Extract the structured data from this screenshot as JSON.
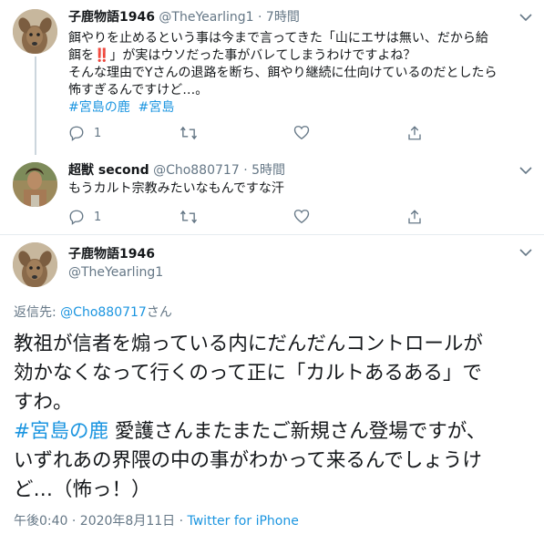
{
  "tweets": [
    {
      "name": "子鹿物語1946",
      "handle": "@TheYearling1",
      "separator": "·",
      "time": "7時間",
      "lines": [
        "餌やりを止めるという事は今まで言ってきた「山にエサは無い、だから給",
        "餌を",
        "」が実はウソだった事がバレてしまうわけですよね？",
        "そんな理由でYさんの退路を断ち、餌やり継続に仕向けているのだとしたら",
        "怖すぎるんですけど…。"
      ],
      "emoji": "‼️",
      "hashtags": [
        "#宮島の鹿",
        "#宮島"
      ],
      "reply_count": "1"
    },
    {
      "name": "超獣 second",
      "handle": "@Cho880717",
      "separator": "·",
      "time": "5時間",
      "text": "もうカルト宗教みたいなもんですな汗",
      "reply_count": "1"
    }
  ],
  "main_tweet": {
    "name": "子鹿物語1946",
    "handle": "@TheYearling1",
    "reply_prefix": "返信先: ",
    "reply_mention": "@Cho880717",
    "reply_suffix": "さん",
    "lines": [
      "教祖が信者を煽っている内にだんだんコントロールが",
      "効かなくなって行くのって正に「カルトあるある」で",
      "すわ。"
    ],
    "hashtag": "#宮島の鹿",
    "line4_rest": " 愛護さんまたまたご新規さん登場ですが、",
    "line5": "いずれあの界隈の中の事がわかって来るんでしょうけ",
    "line6": "ど…（怖っ！）",
    "timestamp": "午後0:40 · 2020年8月11日 · ",
    "client": "Twitter for iPhone"
  },
  "colors": {
    "link": "#1b95e0",
    "muted": "#657786",
    "text": "#14171a",
    "divider": "#e6ecf0"
  },
  "icons": [
    "reply-icon",
    "retweet-icon",
    "like-icon",
    "share-icon",
    "chevron-down-icon"
  ]
}
